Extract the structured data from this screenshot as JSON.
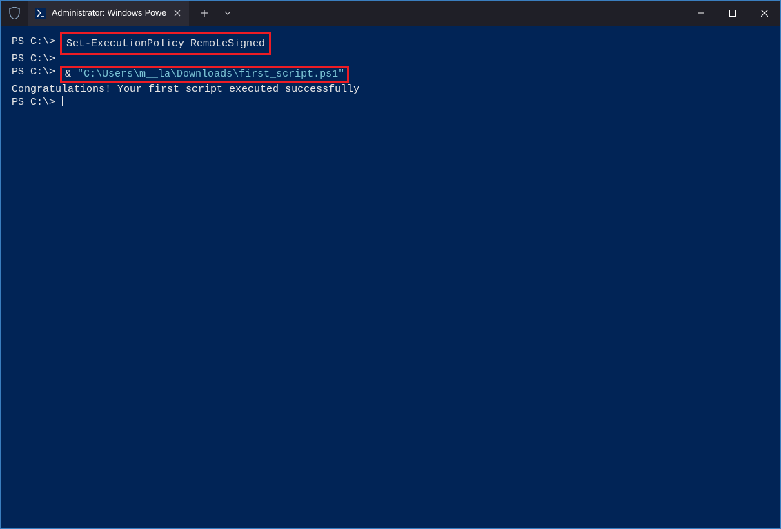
{
  "titlebar": {
    "tab_title": "Administrator: Windows Powe",
    "new_tab_label": "+",
    "dropdown_label": "⌄"
  },
  "terminal": {
    "lines": [
      {
        "prompt": "PS C:\\> ",
        "type": "boxed-command",
        "parts": [
          {
            "text": "Set-ExecutionPolicy RemoteSigned",
            "cls": ""
          }
        ]
      },
      {
        "prompt": "PS C:\\>",
        "type": "plain",
        "parts": []
      },
      {
        "prompt": "PS C:\\> ",
        "type": "boxed-command",
        "parts": [
          {
            "text": "& ",
            "cls": "ampersand"
          },
          {
            "text": "\"C:\\Users\\m__la\\Downloads\\first_script.ps1\"",
            "cls": "path-string"
          }
        ]
      },
      {
        "prompt": "",
        "type": "output",
        "text": "Congratulations! Your first script executed successfully"
      },
      {
        "prompt": "PS C:\\> ",
        "type": "cursor-line"
      }
    ]
  }
}
